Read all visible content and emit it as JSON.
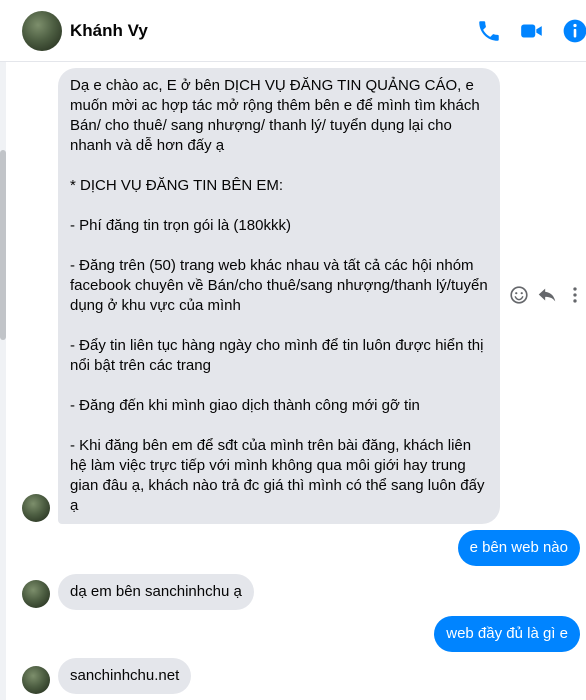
{
  "header": {
    "contact_name": "Khánh Vy",
    "icons": [
      "phone-icon",
      "video-camera-icon",
      "info-icon"
    ],
    "accent_color": "#0084ff"
  },
  "messages": [
    {
      "direction": "incoming",
      "paragraphs": [
        "Dạ e chào ac, E ở bên DỊCH VỤ ĐĂNG TIN QUẢNG CÁO, e muốn mời ac hợp tác mở rộng thêm bên e để mình tìm khách Bán/ cho thuê/ sang nhượng/ thanh lý/ tuyển dụng lại cho nhanh và dễ hơn đấy ạ",
        "* DỊCH VỤ ĐĂNG TIN BÊN EM:",
        "- Phí đăng tin trọn gói là (180kkk)",
        "- Đăng trên (50) trang web khác nhau và tất cả các hội nhóm facebook chuyên về Bán/cho thuê/sang nhượng/thanh lý/tuyển dụng ở khu vực của mình",
        "- Đẩy tin liên tục hàng ngày cho mình để tin luôn được hiển thị nổi bật trên các trang",
        "- Đăng đến khi mình giao dịch thành công mới gỡ tin",
        "- Khi đăng bên em để sđt của mình trên bài đăng, khách liên hệ làm việc trực tiếp với mình không qua môi giới hay trung gian đâu ạ, khách nào trả đc giá thì mình có thể sang luôn đấy ạ"
      ]
    },
    {
      "direction": "outgoing",
      "text": "e bên web nào"
    },
    {
      "direction": "incoming",
      "text": "dạ em bên sanchinhchu ạ"
    },
    {
      "direction": "outgoing",
      "text": "web đầy đủ là gì e"
    },
    {
      "direction": "incoming",
      "text": "sanchinhchu.net"
    }
  ],
  "message_actions": [
    "emoji-react-icon",
    "reply-icon",
    "more-options-icon"
  ]
}
